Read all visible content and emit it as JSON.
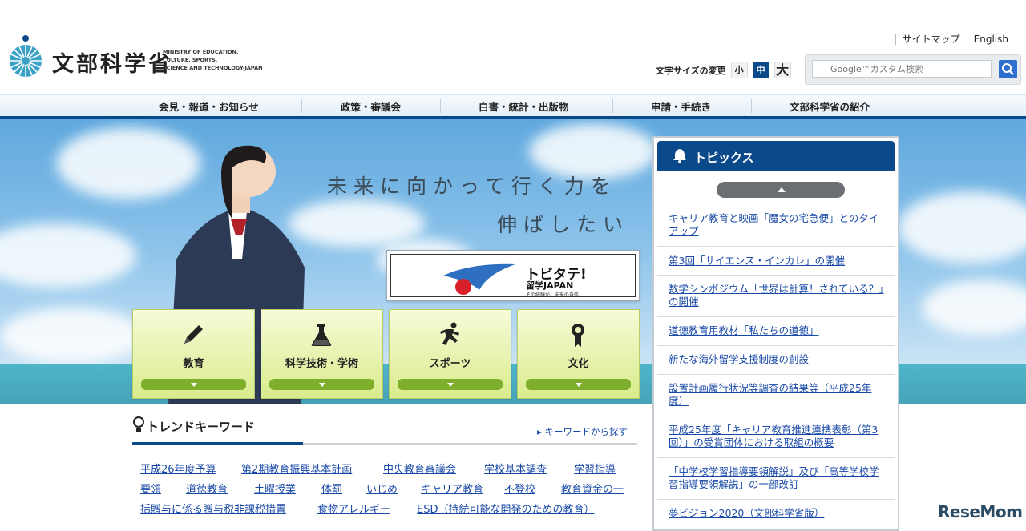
{
  "header": {
    "logo_jp": "文部科学省",
    "logo_en_lines": [
      "MINISTRY OF EDUCATION,",
      "CULTURE, SPORTS,",
      "SCIENCE AND TECHNOLOGY-JAPAN"
    ],
    "util_links": [
      "サイトマップ",
      "English"
    ],
    "font_size_label": "文字サイズの変更",
    "font_size_options": [
      "小",
      "中",
      "大"
    ],
    "font_size_selected": "中",
    "search_placeholder": "Google™カスタム検索"
  },
  "nav": {
    "items": [
      "会見・報道・お知らせ",
      "政策・審議会",
      "白書・統計・出版物",
      "申請・手続き",
      "文部科学省の紹介"
    ]
  },
  "hero": {
    "tagline_line1": "未来に向かって行く力を",
    "tagline_line2": "伸ばしたい",
    "banner_title": "トビタテ!",
    "banner_subtitle": "留学JAPAN",
    "banner_note": "その経験が、未来の自信。"
  },
  "tiles": [
    {
      "label": "教育",
      "icon": "pencil-icon"
    },
    {
      "label": "科学技術・学術",
      "icon": "flask-icon"
    },
    {
      "label": "スポーツ",
      "icon": "runner-icon"
    },
    {
      "label": "文化",
      "icon": "medal-icon"
    }
  ],
  "topics": {
    "title": "トピックス",
    "items": [
      "キャリア教育と映画「魔女の宅急便」とのタイアップ",
      "第3回「サイエンス・インカレ」の開催",
      "数学シンポジウム「世界は計算！されている？」の開催",
      "道徳教育用教材「私たちの道徳」",
      "新たな海外留学支援制度の創設",
      "設置計画履行状況等調査の結果等（平成25年度）",
      "平成25年度「キャリア教育推進連携表彰（第3回）」の受賞団体における取組の概要",
      "「中学校学習指導要領解説」及び「高等学校学習指導要領解説」の一部改訂",
      "夢ビジョン2020（文部科学省版）"
    ]
  },
  "trend": {
    "title": "トレンドキーワード",
    "more_link": "キーワードから探す",
    "keywords": [
      "平成26年度予算",
      "第2期教育振興基本計画",
      "中央教育審議会",
      "学校基本調査",
      "学習指導",
      "要領",
      "道徳教育",
      "土曜授業",
      "体罰",
      "いじめ",
      "キャリア教育",
      "不登校",
      "教育資金の一",
      "括贈与に係る贈与税非課税措置",
      "食物アレルギー",
      "ESD（持続可能な開発のための教育）"
    ]
  },
  "watermark": "ReseMom",
  "colors": {
    "brand_blue": "#0b4a8a",
    "link": "#1a4aa8",
    "tile_green": "#7fae2c",
    "sea": "#4fb5c9"
  }
}
